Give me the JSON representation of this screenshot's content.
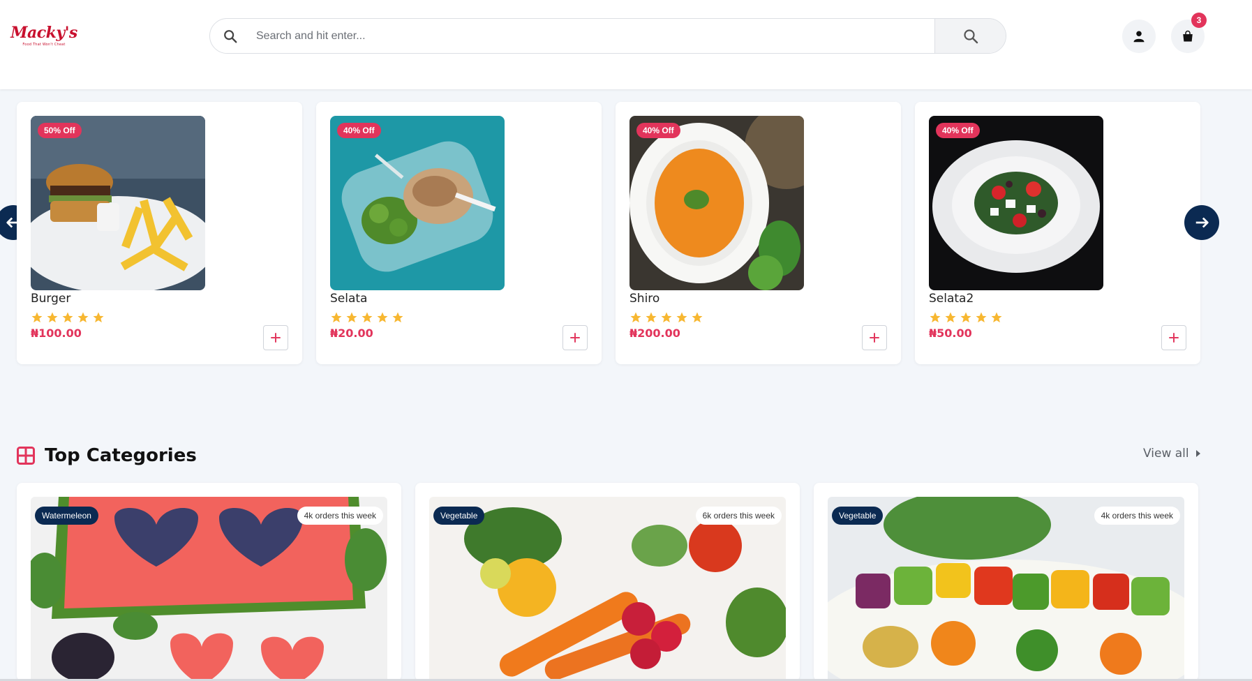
{
  "header": {
    "logo_text": "Macky's",
    "logo_tagline": "Food That Won't Cheat",
    "search_placeholder": "Search and hit enter...",
    "cart_count": "3"
  },
  "products": [
    {
      "name": "Burger",
      "price": "₦100.00",
      "offer": "50% Off",
      "rating": 5
    },
    {
      "name": "Selata",
      "price": "₦20.00",
      "offer": "40% Off",
      "rating": 5
    },
    {
      "name": "Shiro",
      "price": "₦200.00",
      "offer": "40% Off",
      "rating": 5
    },
    {
      "name": "Selata2",
      "price": "₦50.00",
      "offer": "40% Off",
      "rating": 5
    }
  ],
  "categories_section": {
    "title": "Top Categories",
    "view_all": "View all"
  },
  "categories": [
    {
      "tag": "Watermeleon",
      "orders": "4k orders this week"
    },
    {
      "tag": "Vegetable",
      "orders": "6k orders this week"
    },
    {
      "tag": "Vegetable",
      "orders": "4k orders this week"
    }
  ],
  "colors": {
    "accent": "#e2345b",
    "navy": "#0b2a52",
    "star": "#f7b731",
    "background": "#f3f6fa"
  }
}
